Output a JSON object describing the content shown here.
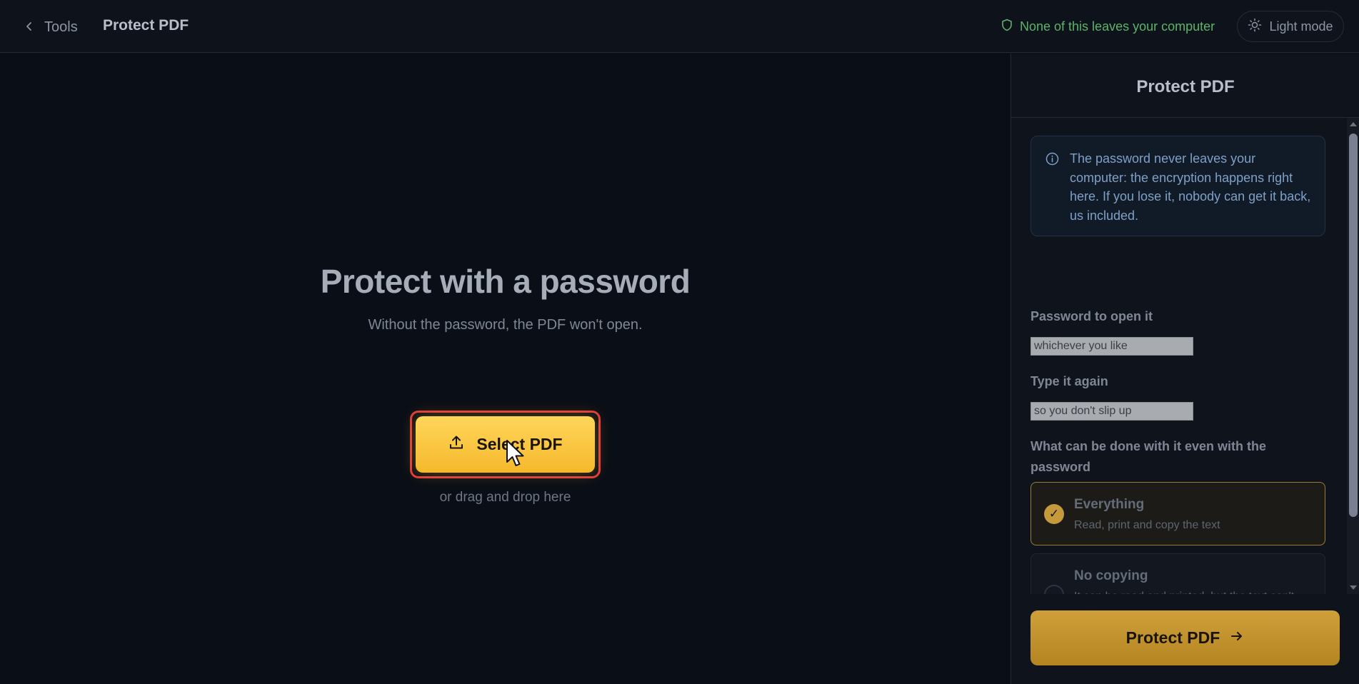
{
  "topbar": {
    "back_label": "Tools",
    "title": "Protect PDF",
    "privacy_note": "None of this leaves your computer",
    "theme_toggle_label": "Light mode"
  },
  "main": {
    "heading": "Protect with a password",
    "subheading": "Without the password, the PDF won't open.",
    "select_button_label": "Select PDF",
    "drag_hint": "or drag and drop here"
  },
  "panel": {
    "title": "Protect PDF",
    "info_text": "The password never leaves your computer: the encryption happens right here. If you lose it, nobody can get it back, us included.",
    "password_label": "Password to open it",
    "password_placeholder": "whichever you like",
    "password_value": "",
    "confirm_label": "Type it again",
    "confirm_placeholder": "so you don't slip up",
    "confirm_value": "",
    "permissions_label": "What can be done with it even with the password",
    "options": [
      {
        "title": "Everything",
        "description": "Read, print and copy the text",
        "selected": true
      },
      {
        "title": "No copying",
        "description": "It can be read and printed, but the text can't be copied",
        "selected": false
      }
    ],
    "submit_label": "Protect PDF"
  },
  "colors": {
    "accent": "#f5b82c",
    "privacy_green": "#5bb46a",
    "background": "#0a0e16",
    "highlight_outline": "#e03a3a"
  },
  "icons": {
    "back": "chevron-left-icon",
    "privacy": "shield-icon",
    "theme": "sun-icon",
    "upload": "upload-icon",
    "info": "info-icon",
    "check": "check-icon",
    "arrow": "arrow-right-icon"
  }
}
